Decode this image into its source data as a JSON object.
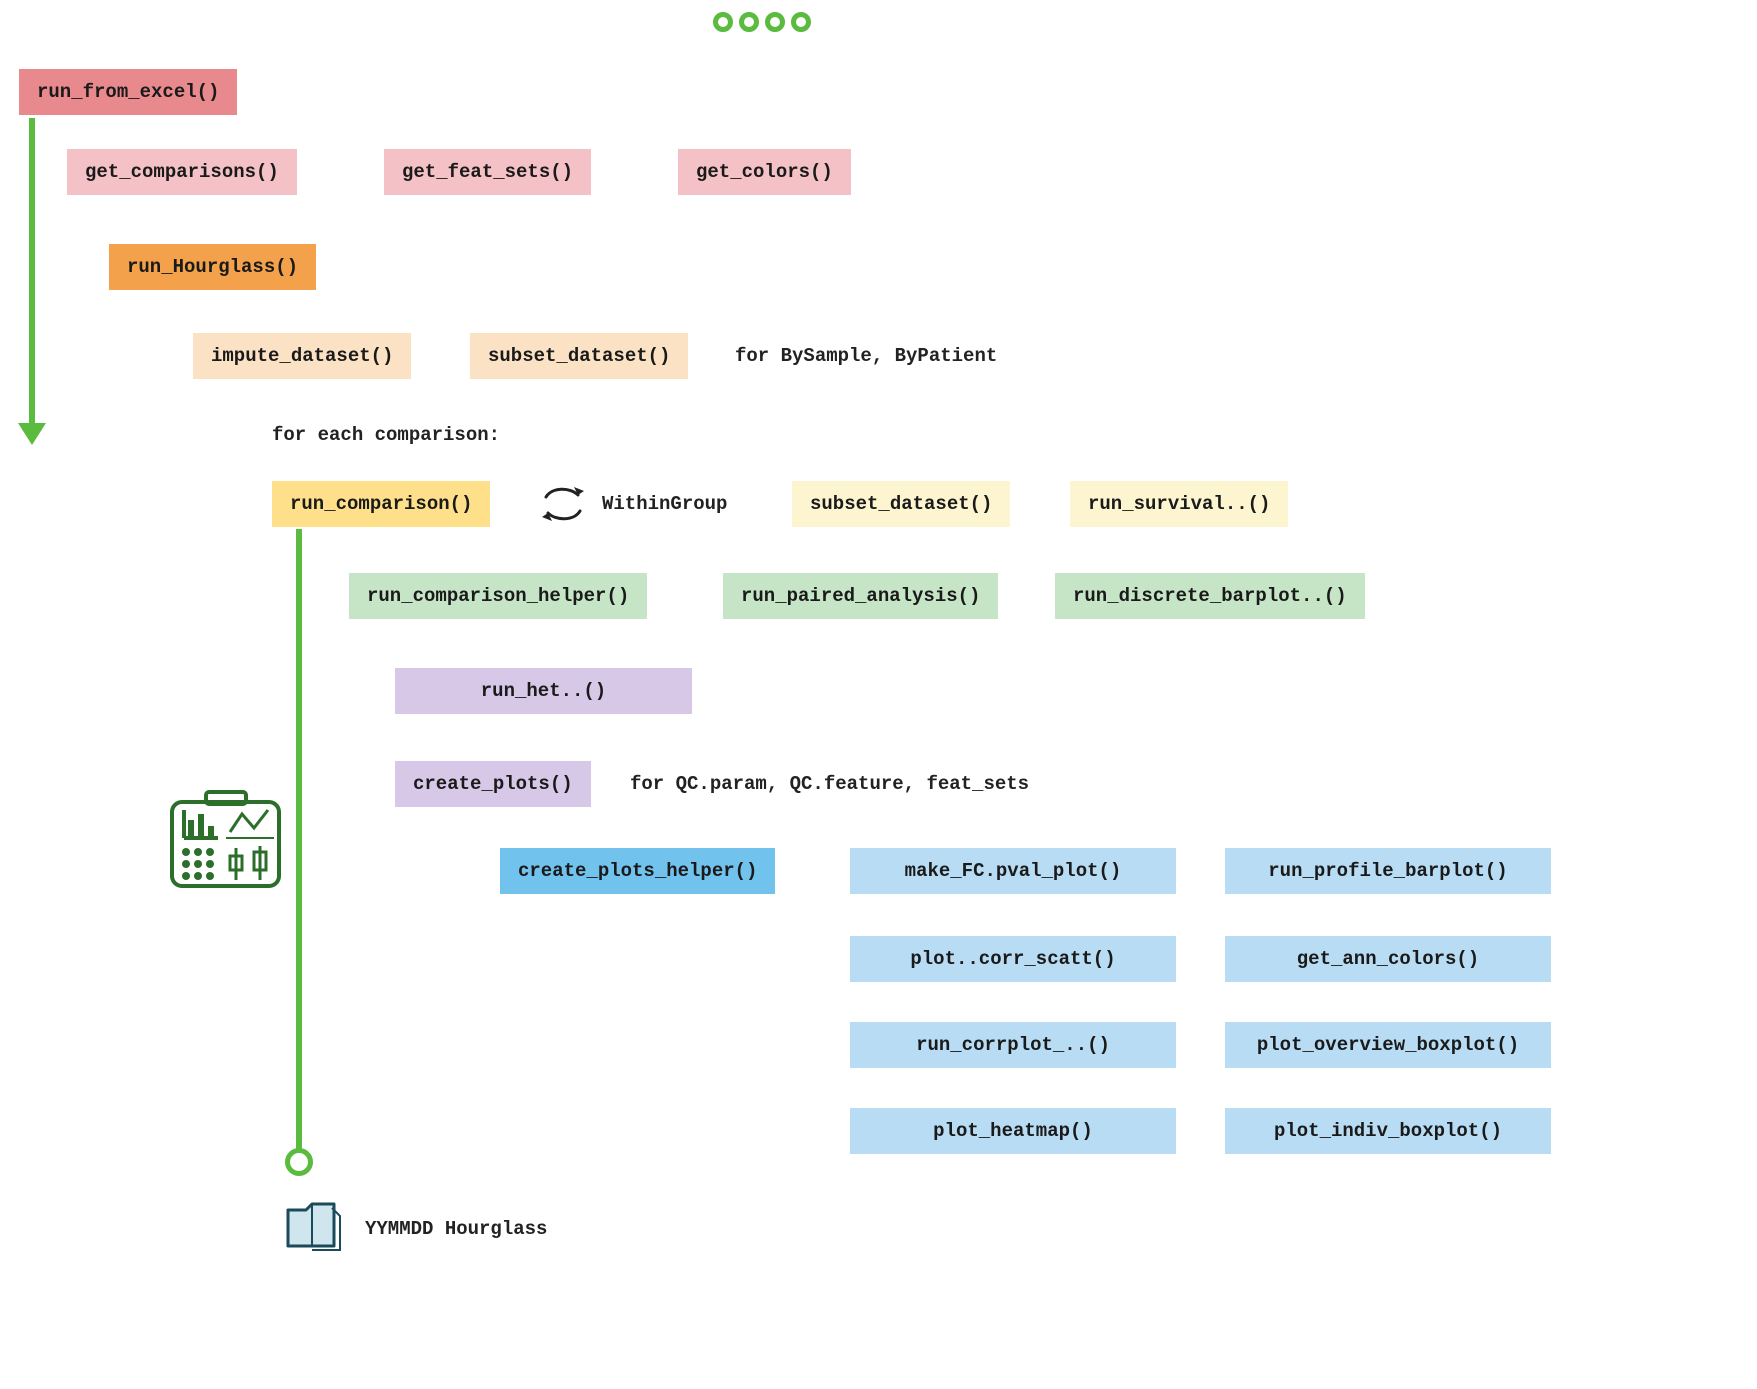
{
  "header_dots_color": "#5bbb3e",
  "blocks": {
    "run_from_excel": "run_from_excel()",
    "get_comparisons": "get_comparisons()",
    "get_feat_sets": "get_feat_sets()",
    "get_colors": "get_colors()",
    "run_hourglass": "run_Hourglass()",
    "impute_dataset": "impute_dataset()",
    "subset_dataset_a": "subset_dataset()",
    "run_comparison": "run_comparison()",
    "subset_dataset_b": "subset_dataset()",
    "run_survival": "run_survival..()",
    "run_comparison_helper": "run_comparison_helper()",
    "run_paired_analysis": "run_paired_analysis()",
    "run_discrete_barplot": "run_discrete_barplot..()",
    "run_het": "run_het..()",
    "create_plots": "create_plots()",
    "create_plots_helper": "create_plots_helper()",
    "make_fc_pval_plot": "make_FC.pval_plot()",
    "run_profile_barplot": "run_profile_barplot()",
    "plot_corr_scatt": "plot..corr_scatt()",
    "get_ann_colors": "get_ann_colors()",
    "run_corrplot": "run_corrplot_..()",
    "plot_overview_boxplot": "plot_overview_boxplot()",
    "plot_heatmap": "plot_heatmap()",
    "plot_indiv_boxplot": "plot_indiv_boxplot()"
  },
  "labels": {
    "by_sample_patient": "for BySample, ByPatient",
    "for_each_comparison": "for each comparison:",
    "within_group": "WithinGroup",
    "qc_params": "for QC.param, QC.feature, feat_sets",
    "folder": "YYMMDD Hourglass"
  }
}
